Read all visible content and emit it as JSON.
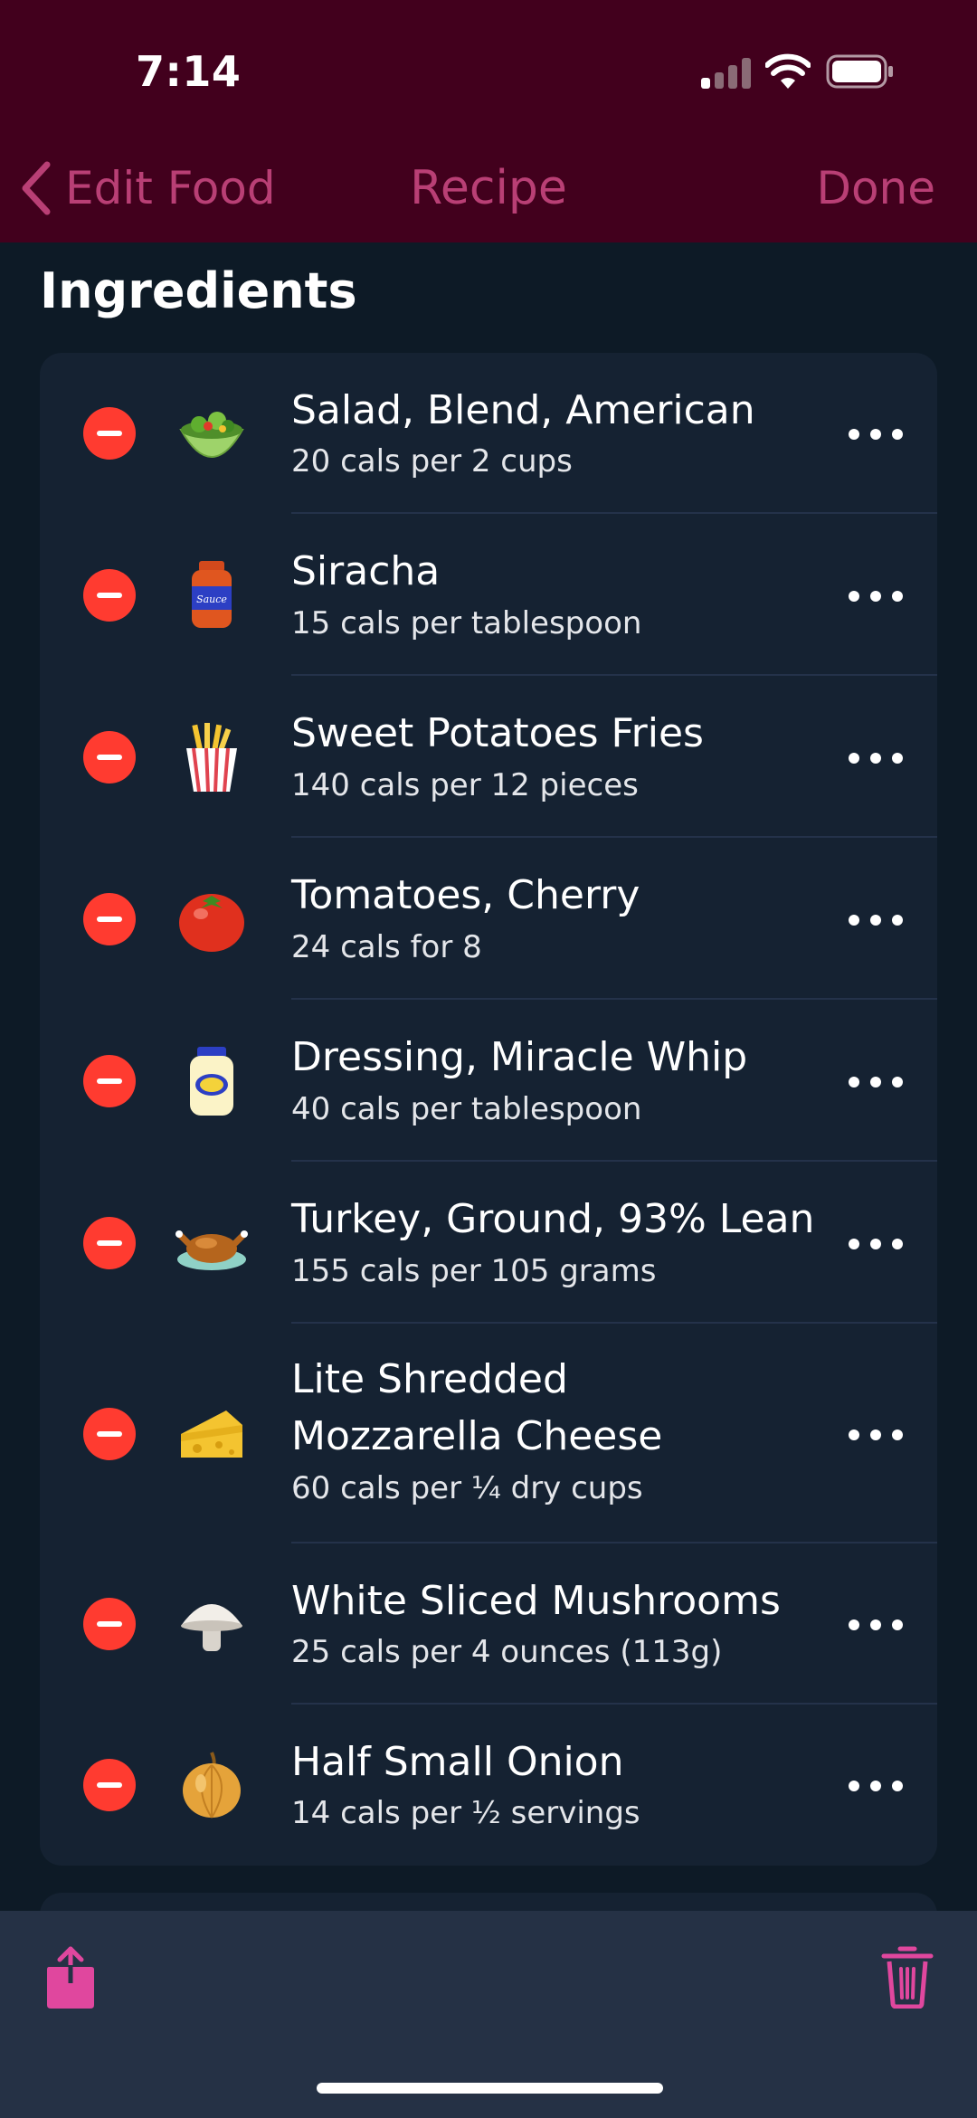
{
  "status_bar": {
    "time": "7:14"
  },
  "nav": {
    "back_label": "Edit Food",
    "title": "Recipe",
    "done_label": "Done"
  },
  "section": {
    "title": "Ingredients"
  },
  "ingredients": [
    {
      "name": "Salad, Blend, American",
      "calories": "20 cals per 2 cups",
      "icon": "salad-bowl-icon"
    },
    {
      "name": "Siracha",
      "calories": "15 cals per tablespoon",
      "icon": "sauce-jar-icon"
    },
    {
      "name": "Sweet Potatoes Fries",
      "calories": "140 cals per 12 pieces",
      "icon": "french-fries-icon"
    },
    {
      "name": "Tomatoes, Cherry",
      "calories": "24 cals for 8",
      "icon": "tomato-icon"
    },
    {
      "name": "Dressing, Miracle Whip",
      "calories": "40 cals per tablespoon",
      "icon": "mayo-jar-icon"
    },
    {
      "name": "Turkey, Ground, 93% Lean",
      "calories": "155 cals per 105 grams",
      "icon": "roast-turkey-icon"
    },
    {
      "name_line1": "Lite Shredded",
      "name_line2": "Mozzarella Cheese",
      "calories": "60 cals per ¼ dry cups",
      "icon": "cheese-icon"
    },
    {
      "name": "White Sliced Mushrooms",
      "calories": "25 cals per 4 ounces (113g)",
      "icon": "mushroom-icon"
    },
    {
      "name": "Half Small Onion",
      "calories": "14 cals per ½ servings",
      "icon": "onion-icon"
    }
  ],
  "toolbar": {
    "share_icon": "share-icon",
    "trash_icon": "trash-icon"
  },
  "colors": {
    "header_bg": "#42001d",
    "accent": "#b93f75",
    "delete_red": "#ff3b30",
    "toolbar_icon": "#e0479e"
  }
}
